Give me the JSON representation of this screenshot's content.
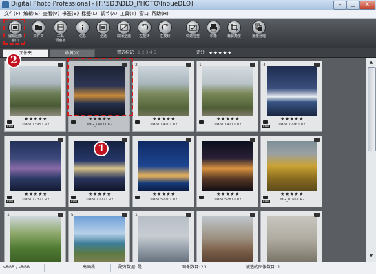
{
  "window": {
    "title": "Digital Photo Professional - [F:\\5D3\\DLO_PHOTO\\InoueDLO]",
    "controls": {
      "minimize": "–",
      "maximize": "□",
      "close": "✕"
    }
  },
  "menu": [
    "文件(F)",
    "编辑(E)",
    "查看(V)",
    "书签(B)",
    "标签(L)",
    "调节(A)",
    "工具(T)",
    "窗口",
    "帮助(H)"
  ],
  "toolbar": [
    {
      "label": "编辑图像\n窗口",
      "icon": "edit-image-window-icon"
    },
    {
      "label": "文件夹",
      "icon": "folder-icon"
    },
    {
      "label": "工具\n调色板",
      "icon": "tool-palette-icon"
    },
    {
      "label": "信息",
      "icon": "info-icon"
    },
    {
      "label": "全选",
      "icon": "select-all-icon"
    },
    {
      "label": "取消全选",
      "icon": "deselect-all-icon"
    },
    {
      "label": "左旋转",
      "icon": "rotate-left-icon"
    },
    {
      "label": "右旋转",
      "icon": "rotate-right-icon"
    },
    {
      "label": "快速检查",
      "icon": "quick-check-icon"
    },
    {
      "label": "印象",
      "icon": "print-icon"
    },
    {
      "label": "裁剪角度",
      "icon": "crop-angle-icon"
    },
    {
      "label": "批量处理",
      "icon": "batch-process-icon"
    }
  ],
  "tabs": {
    "folder": "文件夹",
    "favorites": "收藏(0)"
  },
  "filter": {
    "check_label": "筛选标记",
    "check_numbers": "1 2 3 4 5",
    "rating_label": "评分",
    "rating_stars": "★★★★★"
  },
  "thumbnails": [
    {
      "num": "",
      "stars": "★★★★★",
      "name": "0IKSC1395.CR2",
      "raw": true,
      "scene": "greatwall-1"
    },
    {
      "num": "",
      "stars": "★★★★★",
      "name": "IMG_1403.CR2",
      "raw": false,
      "scene": "night-city",
      "selected": true
    },
    {
      "num": "2",
      "stars": "★★★★★",
      "name": "0IKSC1410.CR2",
      "raw": false,
      "scene": "greatwall-2"
    },
    {
      "num": "1",
      "stars": "★★★★★",
      "name": "0IKSC1421.CR2",
      "raw": false,
      "scene": "greatwall-3"
    },
    {
      "num": "4",
      "stars": "★★★★★",
      "name": "0IKSC1726.CR2",
      "raw": true,
      "scene": "harbor-ship"
    },
    {
      "num": "",
      "stars": "★★★★★",
      "name": "0IKSC1732.CR2",
      "raw": true,
      "scene": "hk-night"
    },
    {
      "num": "",
      "stars": "★★★★★",
      "name": "0IKSC1772.CR2",
      "raw": true,
      "scene": "tower-night"
    },
    {
      "num": "",
      "stars": "★★★★★",
      "name": "0IKSC5220.CR2",
      "raw": false,
      "scene": "bridge-night"
    },
    {
      "num": "",
      "stars": "★★★★★",
      "name": "0IKSC5281.CR2",
      "raw": false,
      "scene": "building-night"
    },
    {
      "num": "",
      "stars": "★★★★★",
      "name": "IMG_0166.CR2",
      "raw": true,
      "scene": "autumn-trees"
    },
    {
      "num": "1",
      "stars": "",
      "name": "",
      "raw": false,
      "scene": "tree-green"
    },
    {
      "num": "5",
      "stars": "",
      "name": "",
      "raw": false,
      "scene": "coast"
    },
    {
      "num": "1",
      "stars": "",
      "name": "",
      "raw": false,
      "scene": "city-haze"
    },
    {
      "num": "",
      "stars": "",
      "name": "",
      "raw": false,
      "scene": "old-town"
    },
    {
      "num": "",
      "stars": "",
      "name": "",
      "raw": false,
      "scene": "haze-sky"
    }
  ],
  "callouts": {
    "one": "1",
    "two": "2"
  },
  "status": {
    "colorspace": "sRGB / sRGB",
    "quality": "高画质",
    "recipe": "配方数据: 是",
    "count": "图像数目: 23",
    "selected": "被选的图像数目: 1"
  }
}
